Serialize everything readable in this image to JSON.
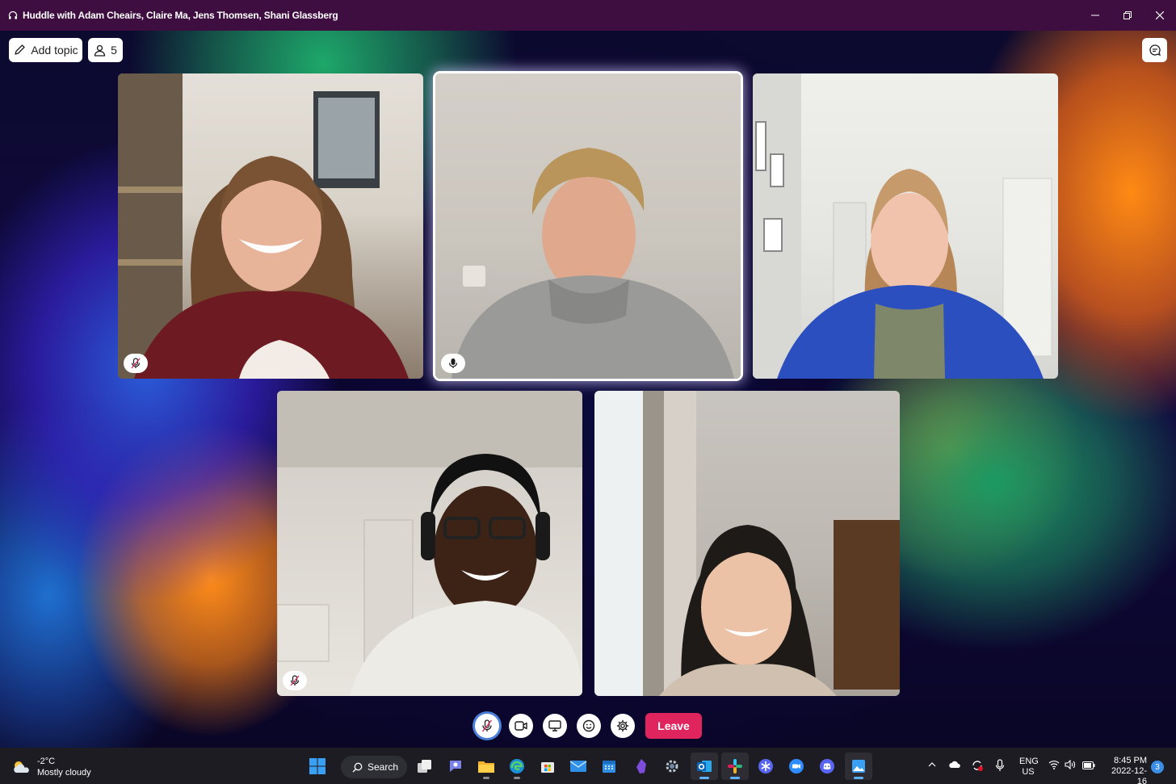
{
  "window": {
    "title": "Huddle with Adam Cheairs, Claire Ma, Jens Thomsen, Shani Glassberg",
    "icon": "headphones-icon"
  },
  "toolbar": {
    "add_topic_label": "Add topic",
    "participant_count": "5"
  },
  "tiles": [
    {
      "name": "participant-1",
      "mic_state": "muted",
      "active_speaker": false
    },
    {
      "name": "participant-2",
      "mic_state": "unmuted",
      "active_speaker": true
    },
    {
      "name": "participant-3",
      "mic_state": "none",
      "active_speaker": false
    },
    {
      "name": "participant-4",
      "mic_state": "muted",
      "active_speaker": false
    },
    {
      "name": "participant-5",
      "mic_state": "none",
      "active_speaker": false
    }
  ],
  "controls": {
    "leave_label": "Leave"
  },
  "taskbar": {
    "weather": {
      "temp": "-2°C",
      "condition": "Mostly cloudy"
    },
    "search_label": "Search",
    "language": {
      "line1": "ENG",
      "line2": "US"
    },
    "clock": {
      "time": "8:45 PM",
      "date": "2022-12-16"
    },
    "notification_count": "3"
  },
  "colors": {
    "titlebar": "#3f0e40",
    "leave": "#e0245e",
    "taskbar": "#1c1c22"
  }
}
